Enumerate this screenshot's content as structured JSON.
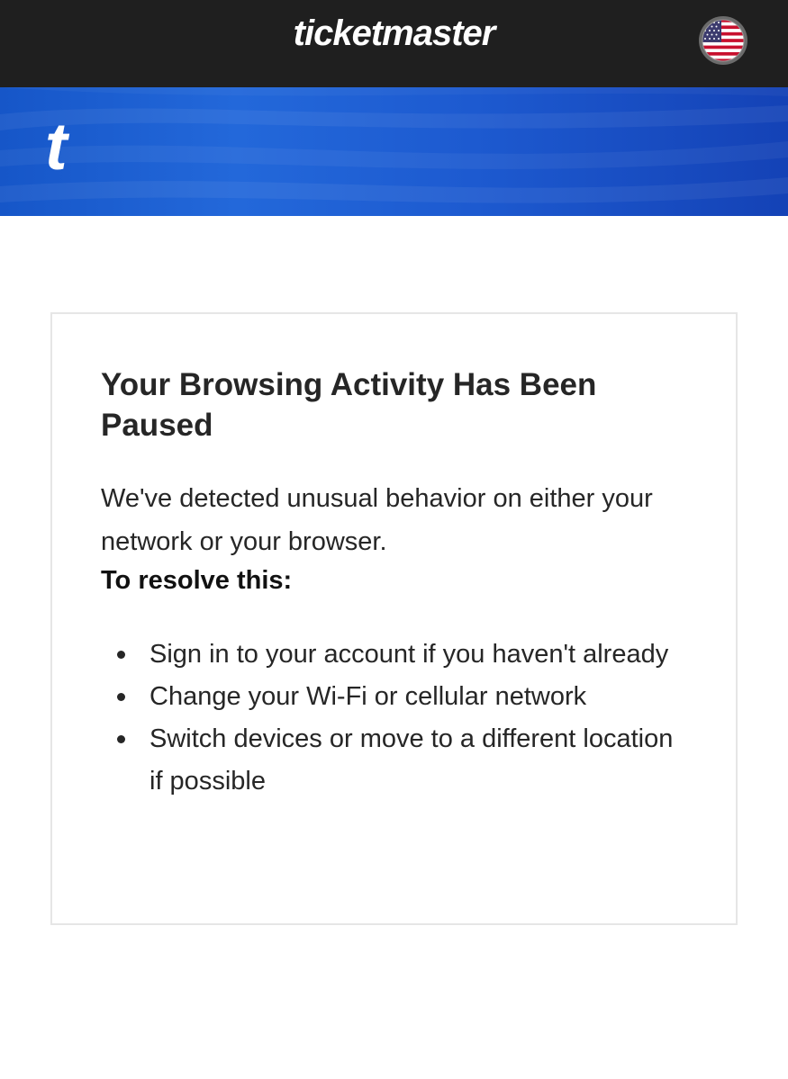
{
  "header": {
    "brand": "ticketmaster",
    "country_icon": "us-flag-icon"
  },
  "banner": {
    "logo": "t"
  },
  "card": {
    "title": "Your Browsing Activity Has Been Paused",
    "description": "We've detected unusual behavior on either your network or your browser.",
    "resolve_label": "To resolve this:",
    "steps": [
      "Sign in to your account if you haven't already",
      "Change your Wi-Fi or cellular network",
      "Switch devices or move to a different location if possible"
    ]
  },
  "colors": {
    "header_bg": "#1f1f1f",
    "banner_blue": "#1d5ad0",
    "text": "#262626",
    "card_border": "#e6e6e6"
  }
}
